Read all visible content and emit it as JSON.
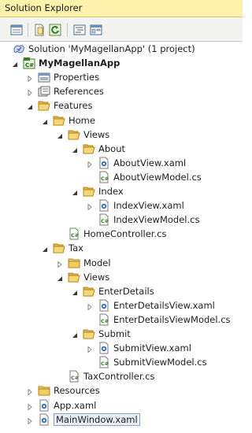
{
  "panel": {
    "title": "Solution Explorer"
  },
  "toolbar": {
    "buttons": [
      {
        "icon": "properties-icon"
      },
      {
        "icon": "show-all-files-icon"
      },
      {
        "icon": "refresh-icon"
      },
      {
        "icon": "view-code-icon"
      },
      {
        "icon": "view-designer-icon"
      }
    ]
  },
  "tree": [
    {
      "label": "Solution 'MyMagellanApp' (1 project)",
      "level": 0,
      "icon": "solution-icon",
      "arrow": "none"
    },
    {
      "label": "MyMagellanApp",
      "level": 1,
      "icon": "csharp-project-icon",
      "arrow": "expanded",
      "bold": true
    },
    {
      "label": "Properties",
      "level": 2,
      "icon": "properties-folder-icon",
      "arrow": "collapsed"
    },
    {
      "label": "References",
      "level": 2,
      "icon": "references-icon",
      "arrow": "collapsed"
    },
    {
      "label": "Features",
      "level": 2,
      "icon": "folder-open-icon",
      "arrow": "expanded"
    },
    {
      "label": "Home",
      "level": 3,
      "icon": "folder-open-icon",
      "arrow": "expanded"
    },
    {
      "label": "Views",
      "level": 4,
      "icon": "folder-open-icon",
      "arrow": "expanded"
    },
    {
      "label": "About",
      "level": 5,
      "icon": "folder-open-icon",
      "arrow": "expanded"
    },
    {
      "label": "AboutView.xaml",
      "level": 6,
      "icon": "xaml-file-icon",
      "arrow": "collapsed"
    },
    {
      "label": "AboutViewModel.cs",
      "level": 6,
      "icon": "csharp-file-icon",
      "arrow": "none"
    },
    {
      "label": "Index",
      "level": 5,
      "icon": "folder-open-icon",
      "arrow": "expanded"
    },
    {
      "label": "IndexView.xaml",
      "level": 6,
      "icon": "xaml-file-icon",
      "arrow": "collapsed"
    },
    {
      "label": "IndexViewModel.cs",
      "level": 6,
      "icon": "csharp-file-icon",
      "arrow": "none"
    },
    {
      "label": "HomeController.cs",
      "level": 4,
      "icon": "csharp-file-icon",
      "arrow": "none"
    },
    {
      "label": "Tax",
      "level": 3,
      "icon": "folder-open-icon",
      "arrow": "expanded"
    },
    {
      "label": "Model",
      "level": 4,
      "icon": "folder-closed-icon",
      "arrow": "collapsed"
    },
    {
      "label": "Views",
      "level": 4,
      "icon": "folder-open-icon",
      "arrow": "expanded"
    },
    {
      "label": "EnterDetails",
      "level": 5,
      "icon": "folder-open-icon",
      "arrow": "expanded"
    },
    {
      "label": "EnterDetailsView.xaml",
      "level": 6,
      "icon": "xaml-file-icon",
      "arrow": "collapsed"
    },
    {
      "label": "EnterDetailsViewModel.cs",
      "level": 6,
      "icon": "csharp-file-icon",
      "arrow": "none"
    },
    {
      "label": "Submit",
      "level": 5,
      "icon": "folder-open-icon",
      "arrow": "expanded"
    },
    {
      "label": "SubmitView.xaml",
      "level": 6,
      "icon": "xaml-file-icon",
      "arrow": "collapsed"
    },
    {
      "label": "SubmitViewModel.cs",
      "level": 6,
      "icon": "csharp-file-icon",
      "arrow": "none"
    },
    {
      "label": "TaxController.cs",
      "level": 4,
      "icon": "csharp-file-icon",
      "arrow": "none"
    },
    {
      "label": "Resources",
      "level": 2,
      "icon": "folder-closed-icon",
      "arrow": "collapsed"
    },
    {
      "label": "App.xaml",
      "level": 2,
      "icon": "xaml-file-icon",
      "arrow": "collapsed"
    },
    {
      "label": "MainWindow.xaml",
      "level": 2,
      "icon": "xaml-file-icon",
      "arrow": "collapsed",
      "selected": true
    }
  ]
}
